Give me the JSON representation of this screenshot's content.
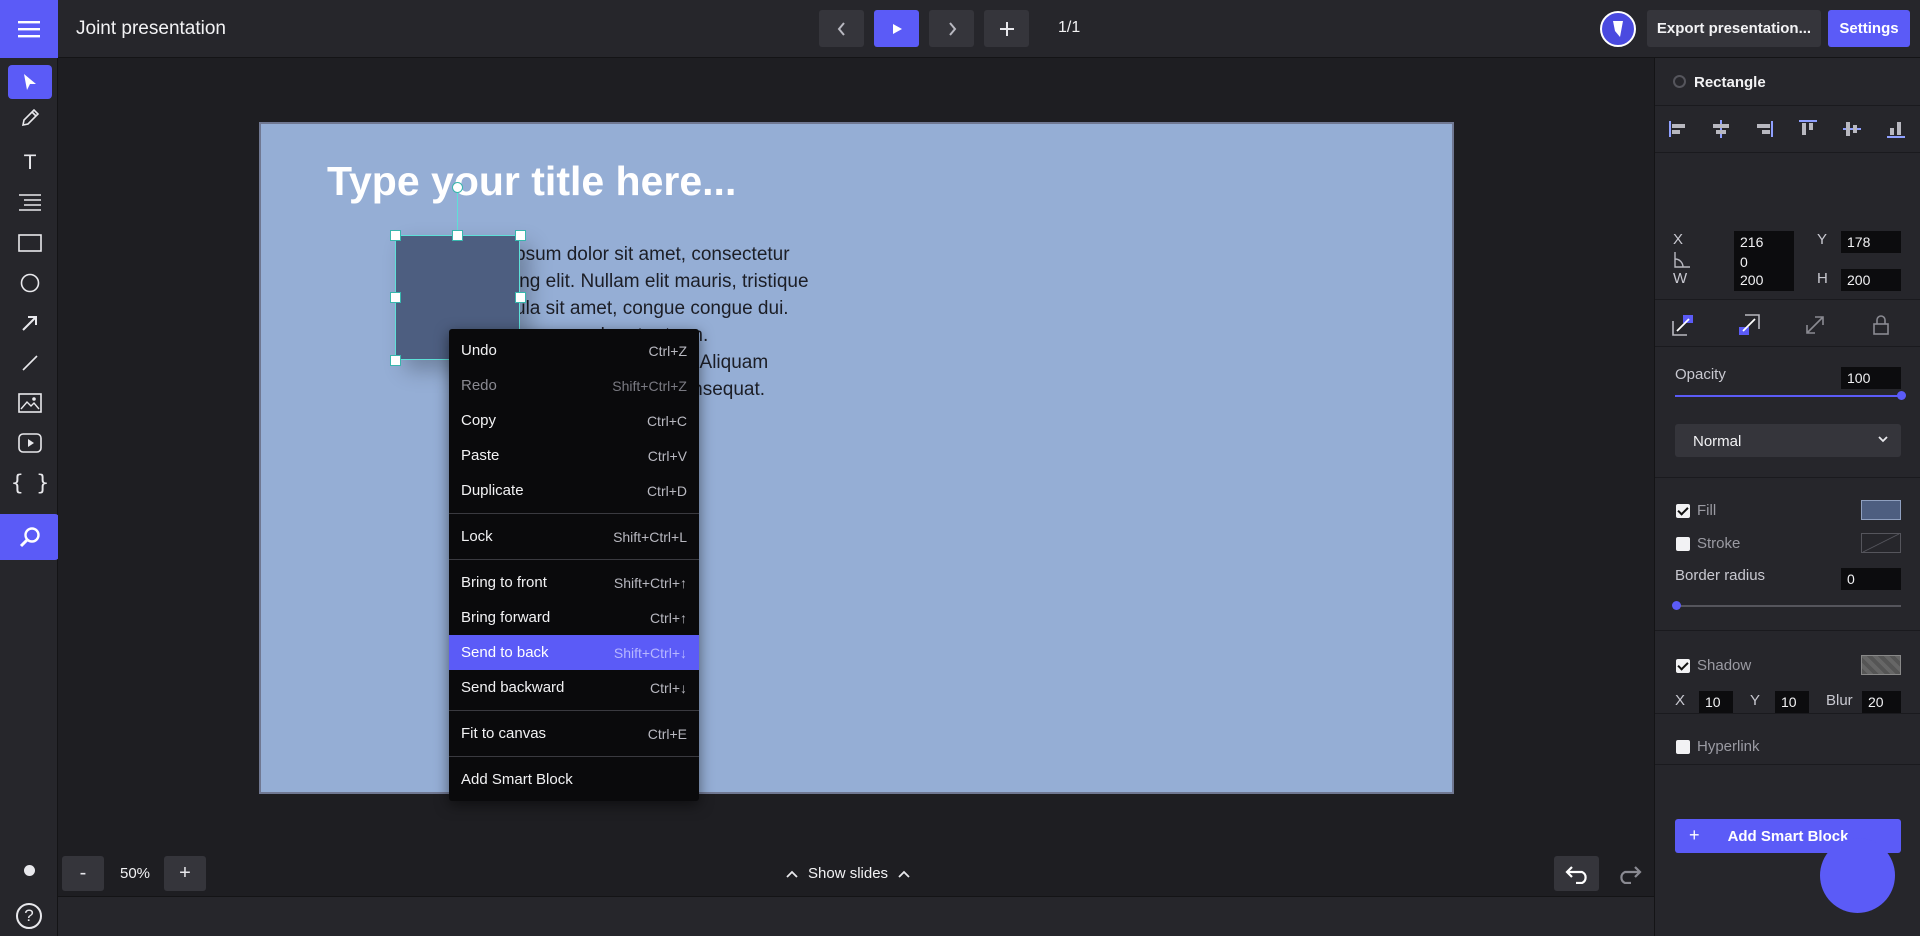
{
  "header": {
    "title": "Joint presentation",
    "page_indicator": "1/1",
    "export_label": "Export presentation...",
    "settings_label": "Settings"
  },
  "slide": {
    "title_placeholder": "Type your title here...",
    "body_lines": [
      "psum dolor sit amet, consectetur",
      "ing elit. Nullam elit mauris, tristique",
      "ula sit amet, congue congue dui.",
      "olor ut rutrum.",
      "empus. Aliquam",
      "rper consequat."
    ]
  },
  "context_menu": {
    "items": [
      {
        "label": "Undo",
        "shortcut": "Ctrl+Z"
      },
      {
        "label": "Redo",
        "shortcut": "Shift+Ctrl+Z"
      },
      {
        "label": "Copy",
        "shortcut": "Ctrl+C"
      },
      {
        "label": "Paste",
        "shortcut": "Ctrl+V"
      },
      {
        "label": "Duplicate",
        "shortcut": "Ctrl+D"
      },
      {
        "label": "Lock",
        "shortcut": "Shift+Ctrl+L"
      },
      {
        "label": "Bring to front",
        "shortcut": "Shift+Ctrl+↑"
      },
      {
        "label": "Bring forward",
        "shortcut": "Ctrl+↑"
      },
      {
        "label": "Send to back",
        "shortcut": "Shift+Ctrl+↓"
      },
      {
        "label": "Send backward",
        "shortcut": "Ctrl+↓"
      },
      {
        "label": "Fit to canvas",
        "shortcut": "Ctrl+E"
      },
      {
        "label": "Add Smart Block",
        "shortcut": ""
      }
    ]
  },
  "bottom": {
    "zoom_minus": "-",
    "zoom_value": "50%",
    "zoom_plus": "+",
    "show_slides": "Show slides"
  },
  "panel": {
    "object_type": "Rectangle",
    "x_label": "X",
    "x_value": "216",
    "y_label": "Y",
    "y_value": "178",
    "w_label": "W",
    "w_value": "200",
    "h_label": "H",
    "h_value": "200",
    "rotation_value": "0",
    "opacity_label": "Opacity",
    "opacity_value": "100",
    "blend_mode": "Normal",
    "fill_label": "Fill",
    "stroke_label": "Stroke",
    "border_radius_label": "Border radius",
    "border_radius_value": "0",
    "shadow_label": "Shadow",
    "shadow_x_label": "X",
    "shadow_x_value": "10",
    "shadow_y_label": "Y",
    "shadow_y_value": "10",
    "shadow_blur_label": "Blur",
    "shadow_blur_value": "20",
    "hyperlink_label": "Hyperlink",
    "add_smart_block_label": "Add Smart Block",
    "add_smart_block_plus": "+"
  },
  "help_label": "?",
  "toolbar_text_glyph": "T",
  "toolbar_code_glyph": "{ }",
  "state": {
    "fill_checked": true,
    "stroke_checked": false,
    "shadow_checked": true,
    "hyperlink_checked": false,
    "opacity_fraction": 1.0,
    "border_radius_fraction": 0.0
  },
  "colors": {
    "accent": "#5b5bf7",
    "slide_background": "#95aed5",
    "shape_fill": "#4d5e80",
    "selection": "#5ee0d8"
  },
  "icons": [
    "hamburger-icon",
    "chevron-left-icon",
    "play-icon",
    "chevron-right-icon",
    "plus-icon",
    "pointer-icon",
    "pencil-icon",
    "text-icon",
    "list-text-icon",
    "rectangle-icon",
    "circle-icon",
    "arrow-icon",
    "line-icon",
    "image-icon",
    "video-icon",
    "code-icon",
    "search-icon",
    "undo-icon",
    "redo-icon",
    "lock-icon"
  ]
}
